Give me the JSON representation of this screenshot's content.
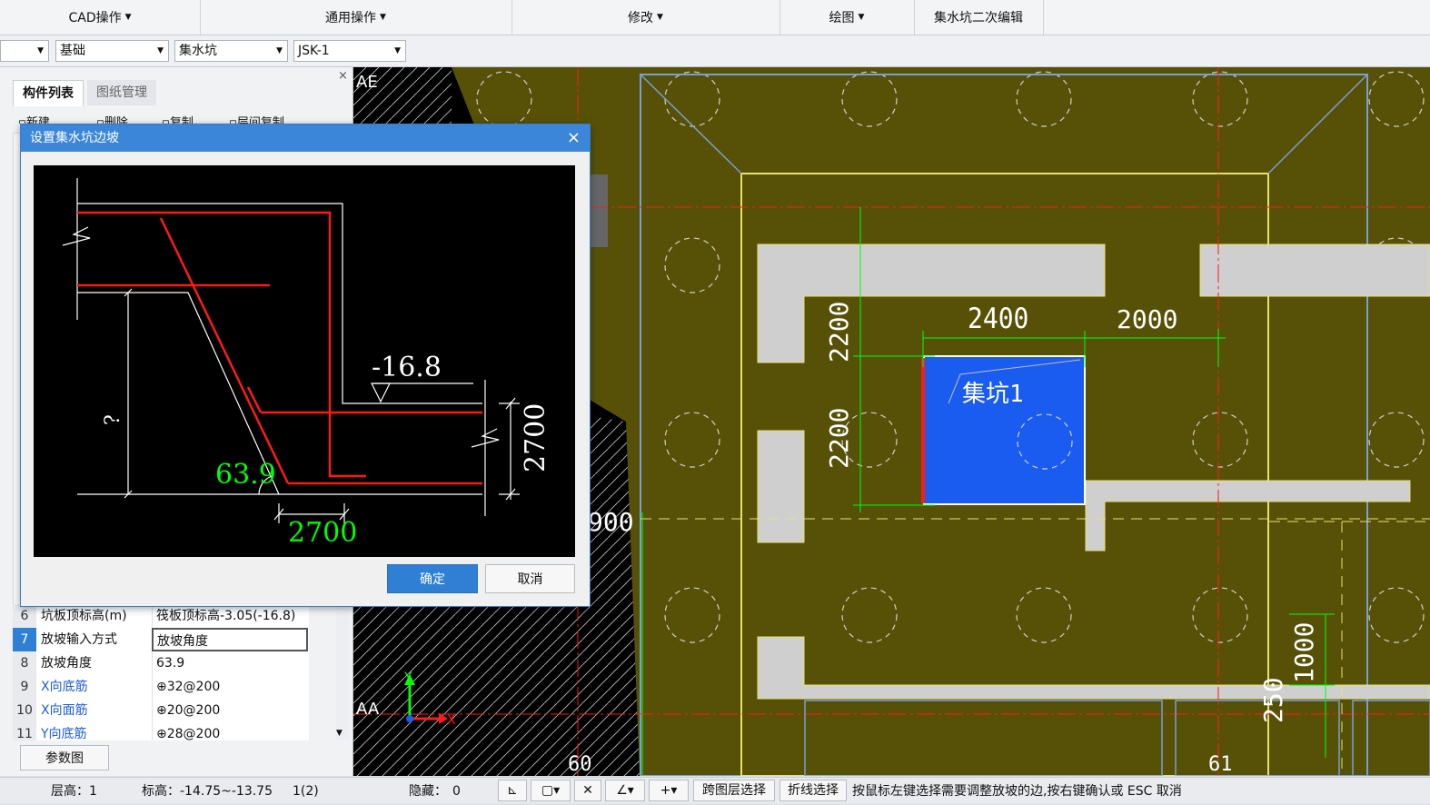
{
  "ribbon": {
    "cad_ops": "CAD操作",
    "common_ops": "通用操作",
    "modify": "修改",
    "draw": "绘图",
    "sump_edit": "集水坑二次编辑"
  },
  "selectors": {
    "category": "基础",
    "type": "集水坑",
    "name": "JSK-1"
  },
  "left_panel": {
    "tab_components": "构件列表",
    "tab_drawings": "图纸管理",
    "tool_new": "新建",
    "tool_delete": "删除",
    "tool_copy": "复制",
    "tool_layer_copy": "层间复制",
    "params_button": "参数图",
    "properties": [
      {
        "num": "6",
        "name": "坑板顶标高(m)",
        "value": "筏板顶标高-3.05(-16.8)",
        "name_color": "#111"
      },
      {
        "num": "7",
        "name": "放坡输入方式",
        "value": "放坡角度",
        "name_color": "#111"
      },
      {
        "num": "8",
        "name": "放坡角度",
        "value": "63.9",
        "name_color": "#111"
      },
      {
        "num": "9",
        "name": "X向底筋",
        "value": "⊕32@200",
        "name_color": "#1e5cd6"
      },
      {
        "num": "10",
        "name": "X向面筋",
        "value": "⊕20@200",
        "name_color": "#1e5cd6"
      },
      {
        "num": "11",
        "name": "Y向底筋",
        "value": "⊕28@200",
        "name_color": "#1e5cd6"
      }
    ]
  },
  "dialog": {
    "title": "设置集水坑边坡",
    "close_icon": "×",
    "ok": "确定",
    "cancel": "取消",
    "diagram": {
      "elevation": "-16.8",
      "depth": "2700",
      "width": "2700",
      "angle": "63.9",
      "unknown": "?"
    }
  },
  "cad": {
    "axis_ae": "AE",
    "axis_aa": "AA",
    "dim_2400": "2400",
    "dim_2000": "2000",
    "dim_2200_a": "2200",
    "dim_2200_b": "2200",
    "dim_1000": "1000",
    "dim_250": "250",
    "dim_900": "900",
    "pit_label": "集坑1",
    "grid_60": "60",
    "grid_61": "61",
    "colors": {
      "olive": "#575107",
      "pit": "#1a5cf0",
      "gray": "#cfcfcf",
      "green": "#00ff00",
      "red": "#ff1a1a",
      "outline": "#7a9fd0"
    }
  },
  "status": {
    "floor_height": "层高：1",
    "elevation": "标高：-14.75~-13.75",
    "count": "1(2)",
    "hidden_label": "隐藏：",
    "hidden_value": "0",
    "cross_layer": "跨图层选择",
    "polyline": "折线选择",
    "hint": "按鼠标左键选择需要调整放坡的边,按右键确认或 ESC 取消"
  }
}
